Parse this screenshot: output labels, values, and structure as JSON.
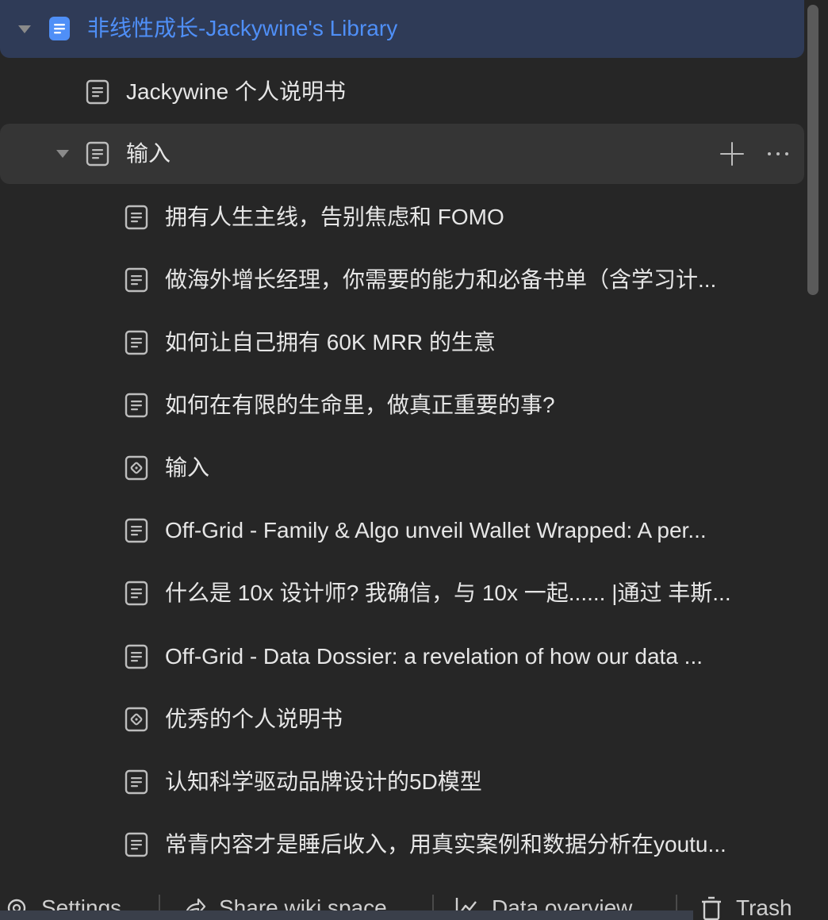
{
  "root": {
    "label": "非线性成长-Jackywine's Library",
    "icon": "document-blue-icon"
  },
  "items": [
    {
      "label": "Jackywine 个人说明书",
      "icon": "document-icon",
      "level": 1
    },
    {
      "label": "输入",
      "icon": "document-icon",
      "level": 1,
      "expanded": true
    },
    {
      "label": "拥有人生主线，告别焦虑和 FOMO",
      "icon": "document-icon",
      "level": 2
    },
    {
      "label": "做海外增长经理，你需要的能力和必备书单（含学习计...",
      "icon": "document-icon",
      "level": 2
    },
    {
      "label": "如何让自己拥有 60K MRR 的生意",
      "icon": "document-icon",
      "level": 2
    },
    {
      "label": "如何在有限的生命里，做真正重要的事?",
      "icon": "document-icon",
      "level": 2
    },
    {
      "label": "输入",
      "icon": "board-icon",
      "level": 2
    },
    {
      "label": "Off-Grid - Family & Algo unveil Wallet Wrapped: A per...",
      "icon": "document-icon",
      "level": 2
    },
    {
      "label": "什么是 10x 设计师? 我确信，与 10x 一起...... |通过 丰斯...",
      "icon": "document-icon",
      "level": 2
    },
    {
      "label": "Off-Grid - Data Dossier: a revelation of how our data ...",
      "icon": "document-icon",
      "level": 2
    },
    {
      "label": "优秀的个人说明书",
      "icon": "board-icon",
      "level": 2
    },
    {
      "label": "认知科学驱动品牌设计的5D模型",
      "icon": "document-icon",
      "level": 2
    },
    {
      "label": "常青内容才是睡后收入，用真实案例和数据分析在youtu...",
      "icon": "document-icon",
      "level": 2
    }
  ],
  "bottom_bar": {
    "settings": "Settings",
    "share": "Share wiki space",
    "data_overview": "Data overview",
    "trash": "Trash"
  },
  "colors": {
    "background": "#262626",
    "selected_background": "#2f3b57",
    "accent": "#4f8ff7"
  }
}
